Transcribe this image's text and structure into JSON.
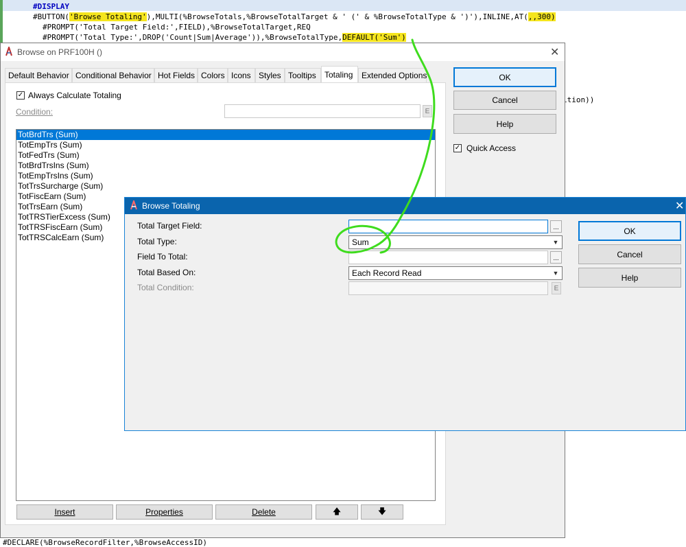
{
  "code": {
    "line1": "#DISPLAY",
    "line2_pre": "#BUTTON(",
    "line2_hl": "'Browse Totaling'",
    "line2_mid": "),MULTI(%BrowseTotals,%BrowseTotalTarget & ' (' & %BrowseTotalType & ')'),INLINE,AT(",
    "line2_hl2": ",,300)",
    "line3": "#PROMPT('Total Target Field:',FIELD),%BrowseTotalTarget,REQ",
    "line4_pre": "#PROMPT('Total Type:',DROP('Count|Sum|Average')),%BrowseTotalType,",
    "line4_hl": "DEFAULT('Sum')",
    "side_fragment": "ition))",
    "bottom_line": "#DECLARE(%BrowseRecordFilter,%BrowseAccessID)"
  },
  "browse_dialog": {
    "title": "Browse on PRF100H ()",
    "tabs": [
      "Default Behavior",
      "Conditional Behavior",
      "Hot Fields",
      "Colors",
      "Icons",
      "Styles",
      "Tooltips",
      "Totaling",
      "Extended Options"
    ],
    "active_tab": "Totaling",
    "always_calc_label": "Always Calculate Totaling",
    "always_calc_checked": "✓",
    "condition_label": "Condition:",
    "e_label": "E",
    "totals": [
      "TotBrdTrs (Sum)",
      "TotEmpTrs (Sum)",
      "TotFedTrs (Sum)",
      "TotBrdTrsIns (Sum)",
      "TotEmpTrsIns (Sum)",
      "TotTrsSurcharge (Sum)",
      "TotFiscEarn (Sum)",
      "TotTrsEarn (Sum)",
      "TotTRSTierExcess (Sum)",
      "TotTRSFiscEarn (Sum)",
      "TotTRSCalcEarn (Sum)"
    ],
    "buttons": {
      "insert": "Insert",
      "properties": "Properties",
      "delete": "Delete",
      "up": "🡅",
      "down": "🡇",
      "ok": "OK",
      "cancel": "Cancel",
      "help": "Help"
    },
    "quick_access_label": "Quick Access",
    "quick_access_checked": "✓"
  },
  "totaling_dialog": {
    "title": "Browse Totaling",
    "fields": {
      "target_label": "Total Target Field:",
      "target_value": "",
      "type_label": "Total Type:",
      "type_value": "Sum",
      "field_label": "Field To Total:",
      "field_value": "",
      "based_label": "Total Based On:",
      "based_value": "Each Record Read",
      "condition_label": "Total Condition:",
      "condition_value": ""
    },
    "dots": "...",
    "e_label": "E",
    "buttons": {
      "ok": "OK",
      "cancel": "Cancel",
      "help": "Help"
    }
  },
  "annotation_color": "#3fdc1e"
}
